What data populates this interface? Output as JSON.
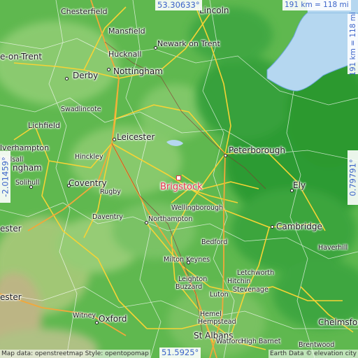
{
  "map": {
    "highlight_place": "Brigstock",
    "coords": {
      "north": "53.30633°",
      "south": "51.5925°",
      "west": "-2.01459°",
      "east": "0.79791°"
    },
    "scale": {
      "horizontal": "191 km = 118 mi",
      "vertical": "191 km = 118 mi"
    },
    "attribution_left": "Map data: openstreetmap Style: opentopomap",
    "attribution_right": "Earth Data © elevation city",
    "places": [
      "Chesterfield",
      "Lincoln",
      "Mansfield",
      "Newark on Trent",
      "Hucknall",
      "e-on-Trent",
      "Derby",
      "Nottingham",
      "Swadlincote",
      "Lichfield",
      "Leicester",
      "Peterborough",
      "lverhampton",
      "Hinckley",
      "Walsall",
      "ngham",
      "Solihull",
      "Coventry",
      "Rugby",
      "Ely",
      "Wellingborough",
      "Daventry",
      "Northampton",
      "Cambridge",
      "ester",
      "Bedford",
      "Haverhill",
      "Milton Keynes",
      "Letchworth",
      "Hitchin",
      "Leighton",
      "Buzzard",
      "Stevenage",
      "ester",
      "Luton",
      "Witney",
      "Oxford",
      "Hemel",
      "Hempstead",
      "Chelmsford",
      "St Albans",
      "Watford",
      "High Barnet",
      "Brentwood",
      "Kettering"
    ],
    "colors": {
      "lowland": "#2f9e35",
      "upland": "#7fc66a",
      "water": "#b5d7f0",
      "road_major": "#f6d335",
      "road_minor": "#ffffff",
      "highlight": "#e8304a",
      "coord_text": "#3b63c9"
    }
  }
}
